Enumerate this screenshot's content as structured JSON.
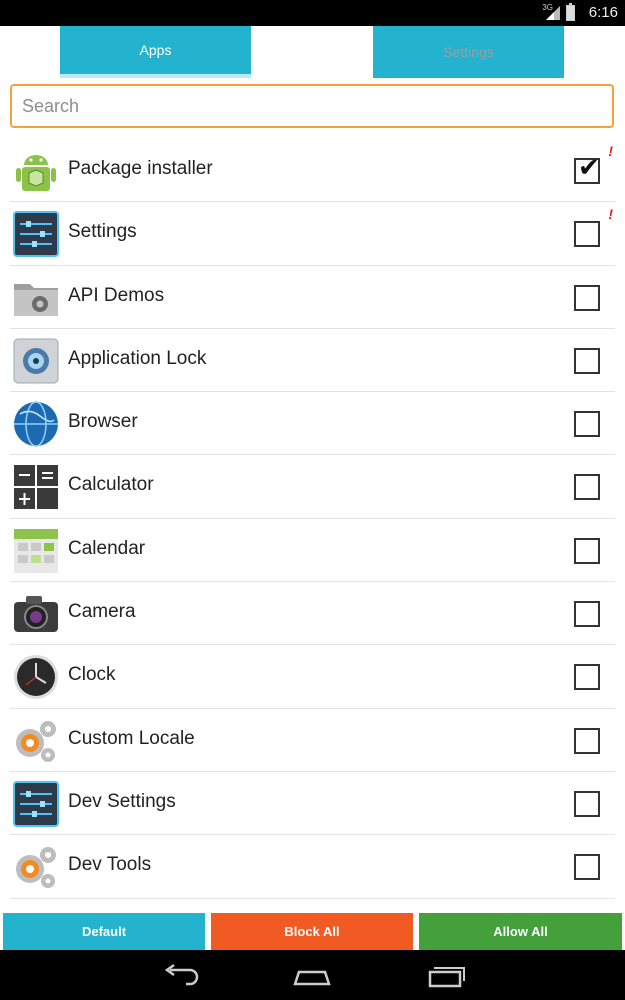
{
  "status_bar": {
    "network": "3G",
    "signal_icon": "signal-bars-icon",
    "battery_icon": "battery-charging-icon",
    "time": "6:16"
  },
  "tabs": [
    {
      "label": "Apps",
      "selected": true
    },
    {
      "label": "Settings",
      "selected": false
    }
  ],
  "search": {
    "placeholder": "Search",
    "value": ""
  },
  "apps": [
    {
      "name": "Package installer",
      "icon": "android-package-icon",
      "checked": true,
      "warning": "!"
    },
    {
      "name": "Settings",
      "icon": "settings-sliders-icon",
      "checked": false,
      "warning": "!"
    },
    {
      "name": "API Demos",
      "icon": "folder-gear-icon",
      "checked": false,
      "warning": ""
    },
    {
      "name": "Application Lock",
      "icon": "vault-lock-icon",
      "checked": false,
      "warning": ""
    },
    {
      "name": "Browser",
      "icon": "globe-icon",
      "checked": false,
      "warning": ""
    },
    {
      "name": "Calculator",
      "icon": "calculator-icon",
      "checked": false,
      "warning": ""
    },
    {
      "name": "Calendar",
      "icon": "calendar-icon",
      "checked": false,
      "warning": ""
    },
    {
      "name": "Camera",
      "icon": "camera-icon",
      "checked": false,
      "warning": ""
    },
    {
      "name": "Clock",
      "icon": "clock-icon",
      "checked": false,
      "warning": ""
    },
    {
      "name": "Custom Locale",
      "icon": "gears-icon",
      "checked": false,
      "warning": ""
    },
    {
      "name": "Dev Settings",
      "icon": "settings-sliders-icon",
      "checked": false,
      "warning": ""
    },
    {
      "name": "Dev Tools",
      "icon": "gears-icon",
      "checked": false,
      "warning": ""
    }
  ],
  "actions": {
    "default_label": "Default",
    "block_all_label": "Block All",
    "allow_all_label": "Allow All"
  },
  "colors": {
    "tab_accent": "#23b3cf",
    "search_border": "#f3a23b",
    "default_button": "#23b3cf",
    "block_button": "#f15a22",
    "allow_button": "#43a03a",
    "warning": "#e02020"
  },
  "nav_bar": {
    "back_icon": "back-icon",
    "home_icon": "home-icon",
    "recents_icon": "recents-icon"
  }
}
